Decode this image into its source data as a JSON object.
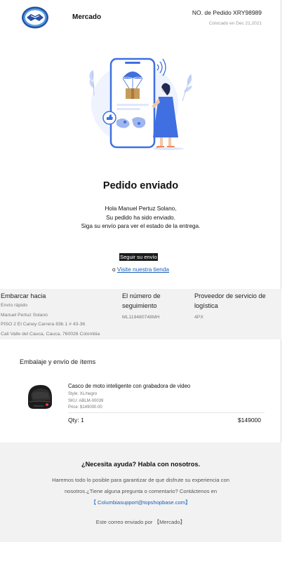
{
  "header": {
    "brand": "Mercado",
    "order_number": "NO. de Pedido XRY98989",
    "order_date": "Colocado en Dec 21,2021",
    "logo_icon": "handshake-logo-icon"
  },
  "hero": {
    "illustration": "parachute-delivery-phone-illustration"
  },
  "main": {
    "title": "Pedido enviado",
    "greeting_lines": [
      "Hola Manuel Pertuz Solano,",
      "Su pedido ha sido enviado.",
      "Siga su envío para ver el estado de la entrega."
    ],
    "track_button": "Seguir su envío",
    "visit_prefix": "o ",
    "visit_link": "Visite nuestra tienda"
  },
  "shipping": {
    "ship_to_header": "Embarcar hacia",
    "ship_method": "Envío rápido",
    "recipient": "Manuel Pertuz Solano",
    "address_line1": "PISO 2 El Caney Carrera 83b 1 # 43-36",
    "address_line2": "Cali Valle del Cauca, Cauca, 760026 Colombia",
    "tracking_header": "El número de seguimiento",
    "tracking_number": "ML119480748MH",
    "provider_header": "Proveedor de servicio de logística",
    "provider": "4PX"
  },
  "items": {
    "section_title": "Embalaje y envío de ítems",
    "product": {
      "name": "Casco de moto inteligente con grabadora de video",
      "style": "Style: XL/negro",
      "sku": "SKU: ABLM-00039",
      "unit_price": "Price: $149000.00",
      "qty": "Qty: 1",
      "total": "$149000",
      "image": "helmet-icon"
    }
  },
  "help": {
    "title": "¿Necesita ayuda? Habla con nosotros.",
    "text_line1": "Haremos todo lo posible para garantizar de que disfrute su experiencia con",
    "text_line2": "nosotros.¿Tiene alguna pregunta o comentario? Contáctenos en",
    "email": "【 Columbiasupport@topshopbase.com】",
    "footer": "Este correo enviado por 【Mercado】"
  },
  "colors": {
    "accent_blue": "#3f6fe0",
    "link_blue": "#1a5fb4",
    "band_gray": "#f2f2f2"
  }
}
